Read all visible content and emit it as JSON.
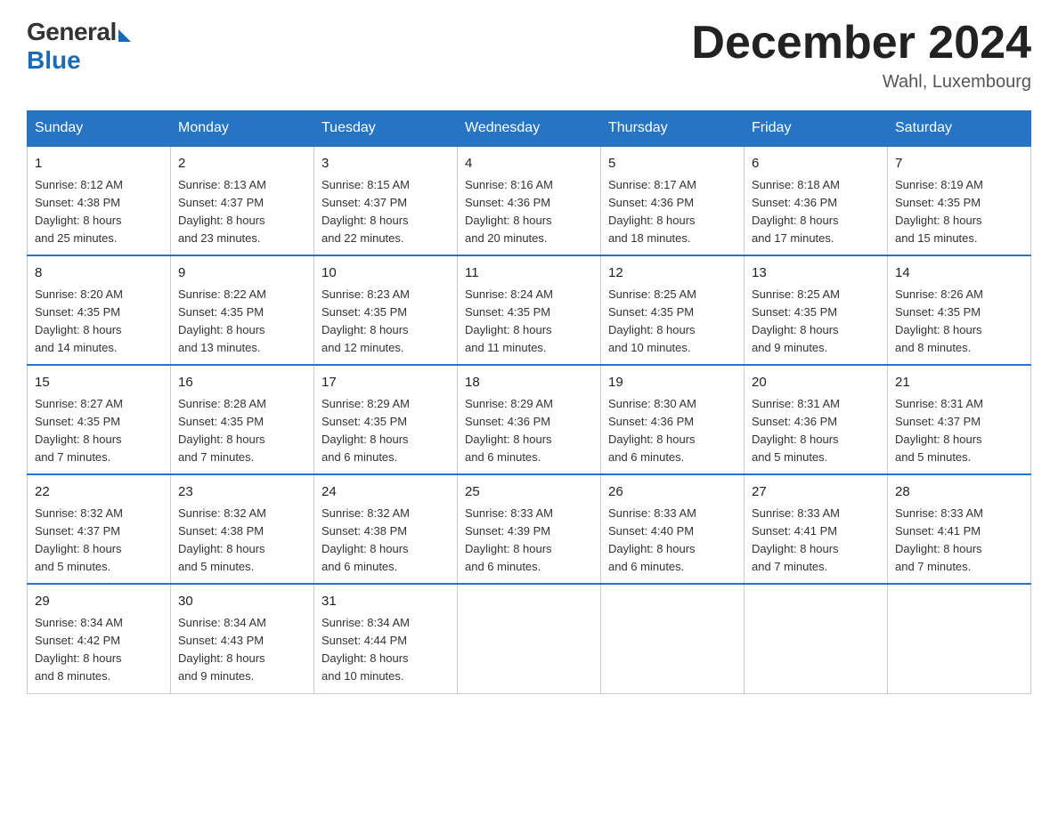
{
  "header": {
    "logo_general": "General",
    "logo_blue": "Blue",
    "month_title": "December 2024",
    "location": "Wahl, Luxembourg"
  },
  "days_of_week": [
    "Sunday",
    "Monday",
    "Tuesday",
    "Wednesday",
    "Thursday",
    "Friday",
    "Saturday"
  ],
  "weeks": [
    [
      {
        "day": "1",
        "info": "Sunrise: 8:12 AM\nSunset: 4:38 PM\nDaylight: 8 hours\nand 25 minutes."
      },
      {
        "day": "2",
        "info": "Sunrise: 8:13 AM\nSunset: 4:37 PM\nDaylight: 8 hours\nand 23 minutes."
      },
      {
        "day": "3",
        "info": "Sunrise: 8:15 AM\nSunset: 4:37 PM\nDaylight: 8 hours\nand 22 minutes."
      },
      {
        "day": "4",
        "info": "Sunrise: 8:16 AM\nSunset: 4:36 PM\nDaylight: 8 hours\nand 20 minutes."
      },
      {
        "day": "5",
        "info": "Sunrise: 8:17 AM\nSunset: 4:36 PM\nDaylight: 8 hours\nand 18 minutes."
      },
      {
        "day": "6",
        "info": "Sunrise: 8:18 AM\nSunset: 4:36 PM\nDaylight: 8 hours\nand 17 minutes."
      },
      {
        "day": "7",
        "info": "Sunrise: 8:19 AM\nSunset: 4:35 PM\nDaylight: 8 hours\nand 15 minutes."
      }
    ],
    [
      {
        "day": "8",
        "info": "Sunrise: 8:20 AM\nSunset: 4:35 PM\nDaylight: 8 hours\nand 14 minutes."
      },
      {
        "day": "9",
        "info": "Sunrise: 8:22 AM\nSunset: 4:35 PM\nDaylight: 8 hours\nand 13 minutes."
      },
      {
        "day": "10",
        "info": "Sunrise: 8:23 AM\nSunset: 4:35 PM\nDaylight: 8 hours\nand 12 minutes."
      },
      {
        "day": "11",
        "info": "Sunrise: 8:24 AM\nSunset: 4:35 PM\nDaylight: 8 hours\nand 11 minutes."
      },
      {
        "day": "12",
        "info": "Sunrise: 8:25 AM\nSunset: 4:35 PM\nDaylight: 8 hours\nand 10 minutes."
      },
      {
        "day": "13",
        "info": "Sunrise: 8:25 AM\nSunset: 4:35 PM\nDaylight: 8 hours\nand 9 minutes."
      },
      {
        "day": "14",
        "info": "Sunrise: 8:26 AM\nSunset: 4:35 PM\nDaylight: 8 hours\nand 8 minutes."
      }
    ],
    [
      {
        "day": "15",
        "info": "Sunrise: 8:27 AM\nSunset: 4:35 PM\nDaylight: 8 hours\nand 7 minutes."
      },
      {
        "day": "16",
        "info": "Sunrise: 8:28 AM\nSunset: 4:35 PM\nDaylight: 8 hours\nand 7 minutes."
      },
      {
        "day": "17",
        "info": "Sunrise: 8:29 AM\nSunset: 4:35 PM\nDaylight: 8 hours\nand 6 minutes."
      },
      {
        "day": "18",
        "info": "Sunrise: 8:29 AM\nSunset: 4:36 PM\nDaylight: 8 hours\nand 6 minutes."
      },
      {
        "day": "19",
        "info": "Sunrise: 8:30 AM\nSunset: 4:36 PM\nDaylight: 8 hours\nand 6 minutes."
      },
      {
        "day": "20",
        "info": "Sunrise: 8:31 AM\nSunset: 4:36 PM\nDaylight: 8 hours\nand 5 minutes."
      },
      {
        "day": "21",
        "info": "Sunrise: 8:31 AM\nSunset: 4:37 PM\nDaylight: 8 hours\nand 5 minutes."
      }
    ],
    [
      {
        "day": "22",
        "info": "Sunrise: 8:32 AM\nSunset: 4:37 PM\nDaylight: 8 hours\nand 5 minutes."
      },
      {
        "day": "23",
        "info": "Sunrise: 8:32 AM\nSunset: 4:38 PM\nDaylight: 8 hours\nand 5 minutes."
      },
      {
        "day": "24",
        "info": "Sunrise: 8:32 AM\nSunset: 4:38 PM\nDaylight: 8 hours\nand 6 minutes."
      },
      {
        "day": "25",
        "info": "Sunrise: 8:33 AM\nSunset: 4:39 PM\nDaylight: 8 hours\nand 6 minutes."
      },
      {
        "day": "26",
        "info": "Sunrise: 8:33 AM\nSunset: 4:40 PM\nDaylight: 8 hours\nand 6 minutes."
      },
      {
        "day": "27",
        "info": "Sunrise: 8:33 AM\nSunset: 4:41 PM\nDaylight: 8 hours\nand 7 minutes."
      },
      {
        "day": "28",
        "info": "Sunrise: 8:33 AM\nSunset: 4:41 PM\nDaylight: 8 hours\nand 7 minutes."
      }
    ],
    [
      {
        "day": "29",
        "info": "Sunrise: 8:34 AM\nSunset: 4:42 PM\nDaylight: 8 hours\nand 8 minutes."
      },
      {
        "day": "30",
        "info": "Sunrise: 8:34 AM\nSunset: 4:43 PM\nDaylight: 8 hours\nand 9 minutes."
      },
      {
        "day": "31",
        "info": "Sunrise: 8:34 AM\nSunset: 4:44 PM\nDaylight: 8 hours\nand 10 minutes."
      },
      {
        "day": "",
        "info": ""
      },
      {
        "day": "",
        "info": ""
      },
      {
        "day": "",
        "info": ""
      },
      {
        "day": "",
        "info": ""
      }
    ]
  ]
}
